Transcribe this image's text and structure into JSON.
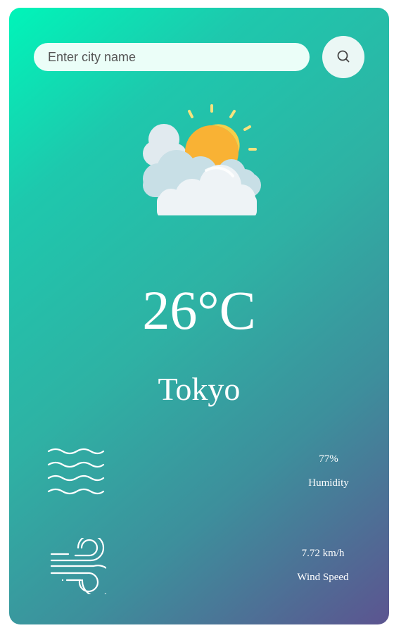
{
  "search": {
    "placeholder": "Enter city name",
    "button_icon": "search-icon"
  },
  "weather": {
    "icon": "sun-behind-clouds-icon",
    "temperature": "26°C",
    "city": "Tokyo"
  },
  "details": {
    "humidity": {
      "icon": "humidity-waves-icon",
      "value": "77%",
      "label": "Humidity"
    },
    "wind": {
      "icon": "wind-icon",
      "value": "7.72 km/h",
      "label": "Wind Speed"
    }
  },
  "colors": {
    "gradient_start": "#00f5b9",
    "gradient_end": "#5c5490",
    "text": "#ffffff",
    "sun": "#f9b234",
    "cloud": "#eef3f6"
  }
}
